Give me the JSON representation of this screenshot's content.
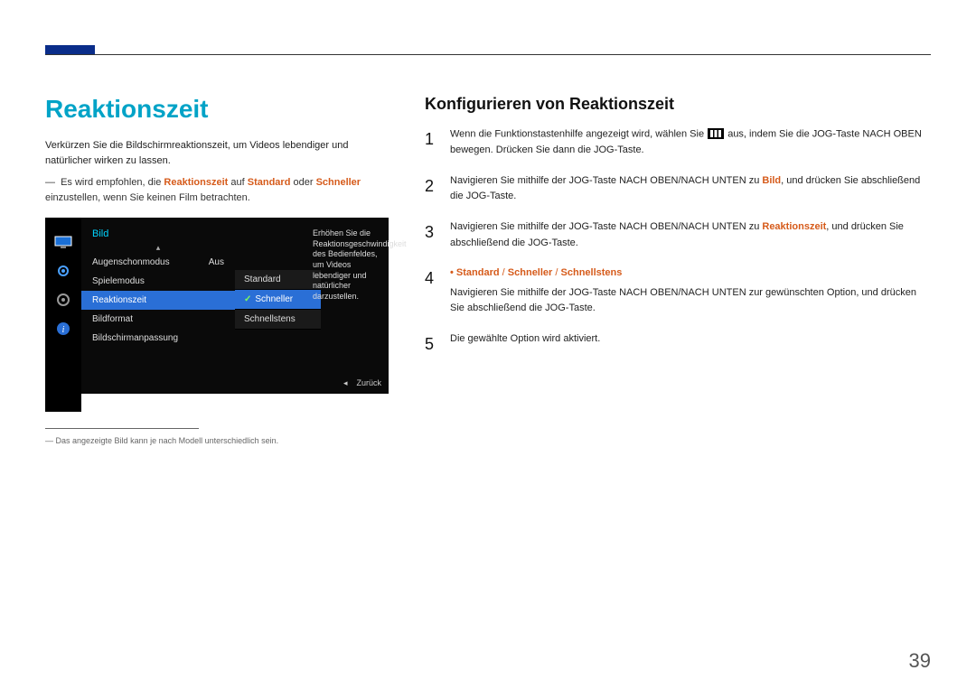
{
  "header": {
    "title": "Reaktionszeit"
  },
  "left": {
    "intro": "Verkürzen Sie die Bildschirmreaktionszeit, um Videos lebendiger und natürlicher wirken zu lassen.",
    "note_pre": "Es wird empfohlen, die ",
    "note_hl1": "Reaktionszeit",
    "note_mid": " auf ",
    "note_hl2": "Standard",
    "note_mid2": " oder ",
    "note_hl3": "Schneller",
    "note_post": " einzustellen, wenn Sie keinen Film betrachten.",
    "footnote": "Das angezeigte Bild kann je nach Modell unterschiedlich sein."
  },
  "osd": {
    "title": "Bild",
    "items": [
      {
        "label": "Augenschonmodus",
        "value": "Aus"
      },
      {
        "label": "Spielemodus",
        "value": ""
      },
      {
        "label": "Reaktionszeit",
        "value": ""
      },
      {
        "label": "Bildformat",
        "value": ""
      },
      {
        "label": "Bildschirmanpassung",
        "value": ""
      }
    ],
    "sub": [
      "Standard",
      "Schneller",
      "Schnellstens"
    ],
    "desc": "Erhöhen Sie die Reaktionsgeschwindigkeit des Bedienfeldes, um Videos lebendiger und natürlicher darzustellen.",
    "back": "Zurück"
  },
  "right": {
    "title": "Konfigurieren von Reaktionszeit",
    "steps": [
      {
        "n": "1",
        "pre": "Wenn die Funktionstastenhilfe angezeigt wird, wählen Sie ",
        "post": " aus, indem Sie die JOG-Taste NACH OBEN bewegen. Drücken Sie dann die JOG-Taste."
      },
      {
        "n": "2",
        "pre": "Navigieren Sie mithilfe der JOG-Taste NACH OBEN/NACH UNTEN zu ",
        "hl": "Bild",
        "post": ", und drücken Sie abschließend die JOG-Taste."
      },
      {
        "n": "3",
        "pre": "Navigieren Sie mithilfe der JOG-Taste NACH OBEN/NACH UNTEN zu ",
        "hl": "Reaktionszeit",
        "post": ", und drücken Sie abschließend die JOG-Taste."
      },
      {
        "n": "4",
        "text": "Navigieren Sie mithilfe der JOG-Taste NACH OBEN/NACH UNTEN zur gewünschten Option, und drücken Sie abschließend die JOG-Taste."
      },
      {
        "n": "5",
        "text": "Die gewählte Option wird aktiviert."
      }
    ],
    "options": [
      "Standard",
      "Schneller",
      "Schnellstens"
    ]
  },
  "pagenum": "39"
}
